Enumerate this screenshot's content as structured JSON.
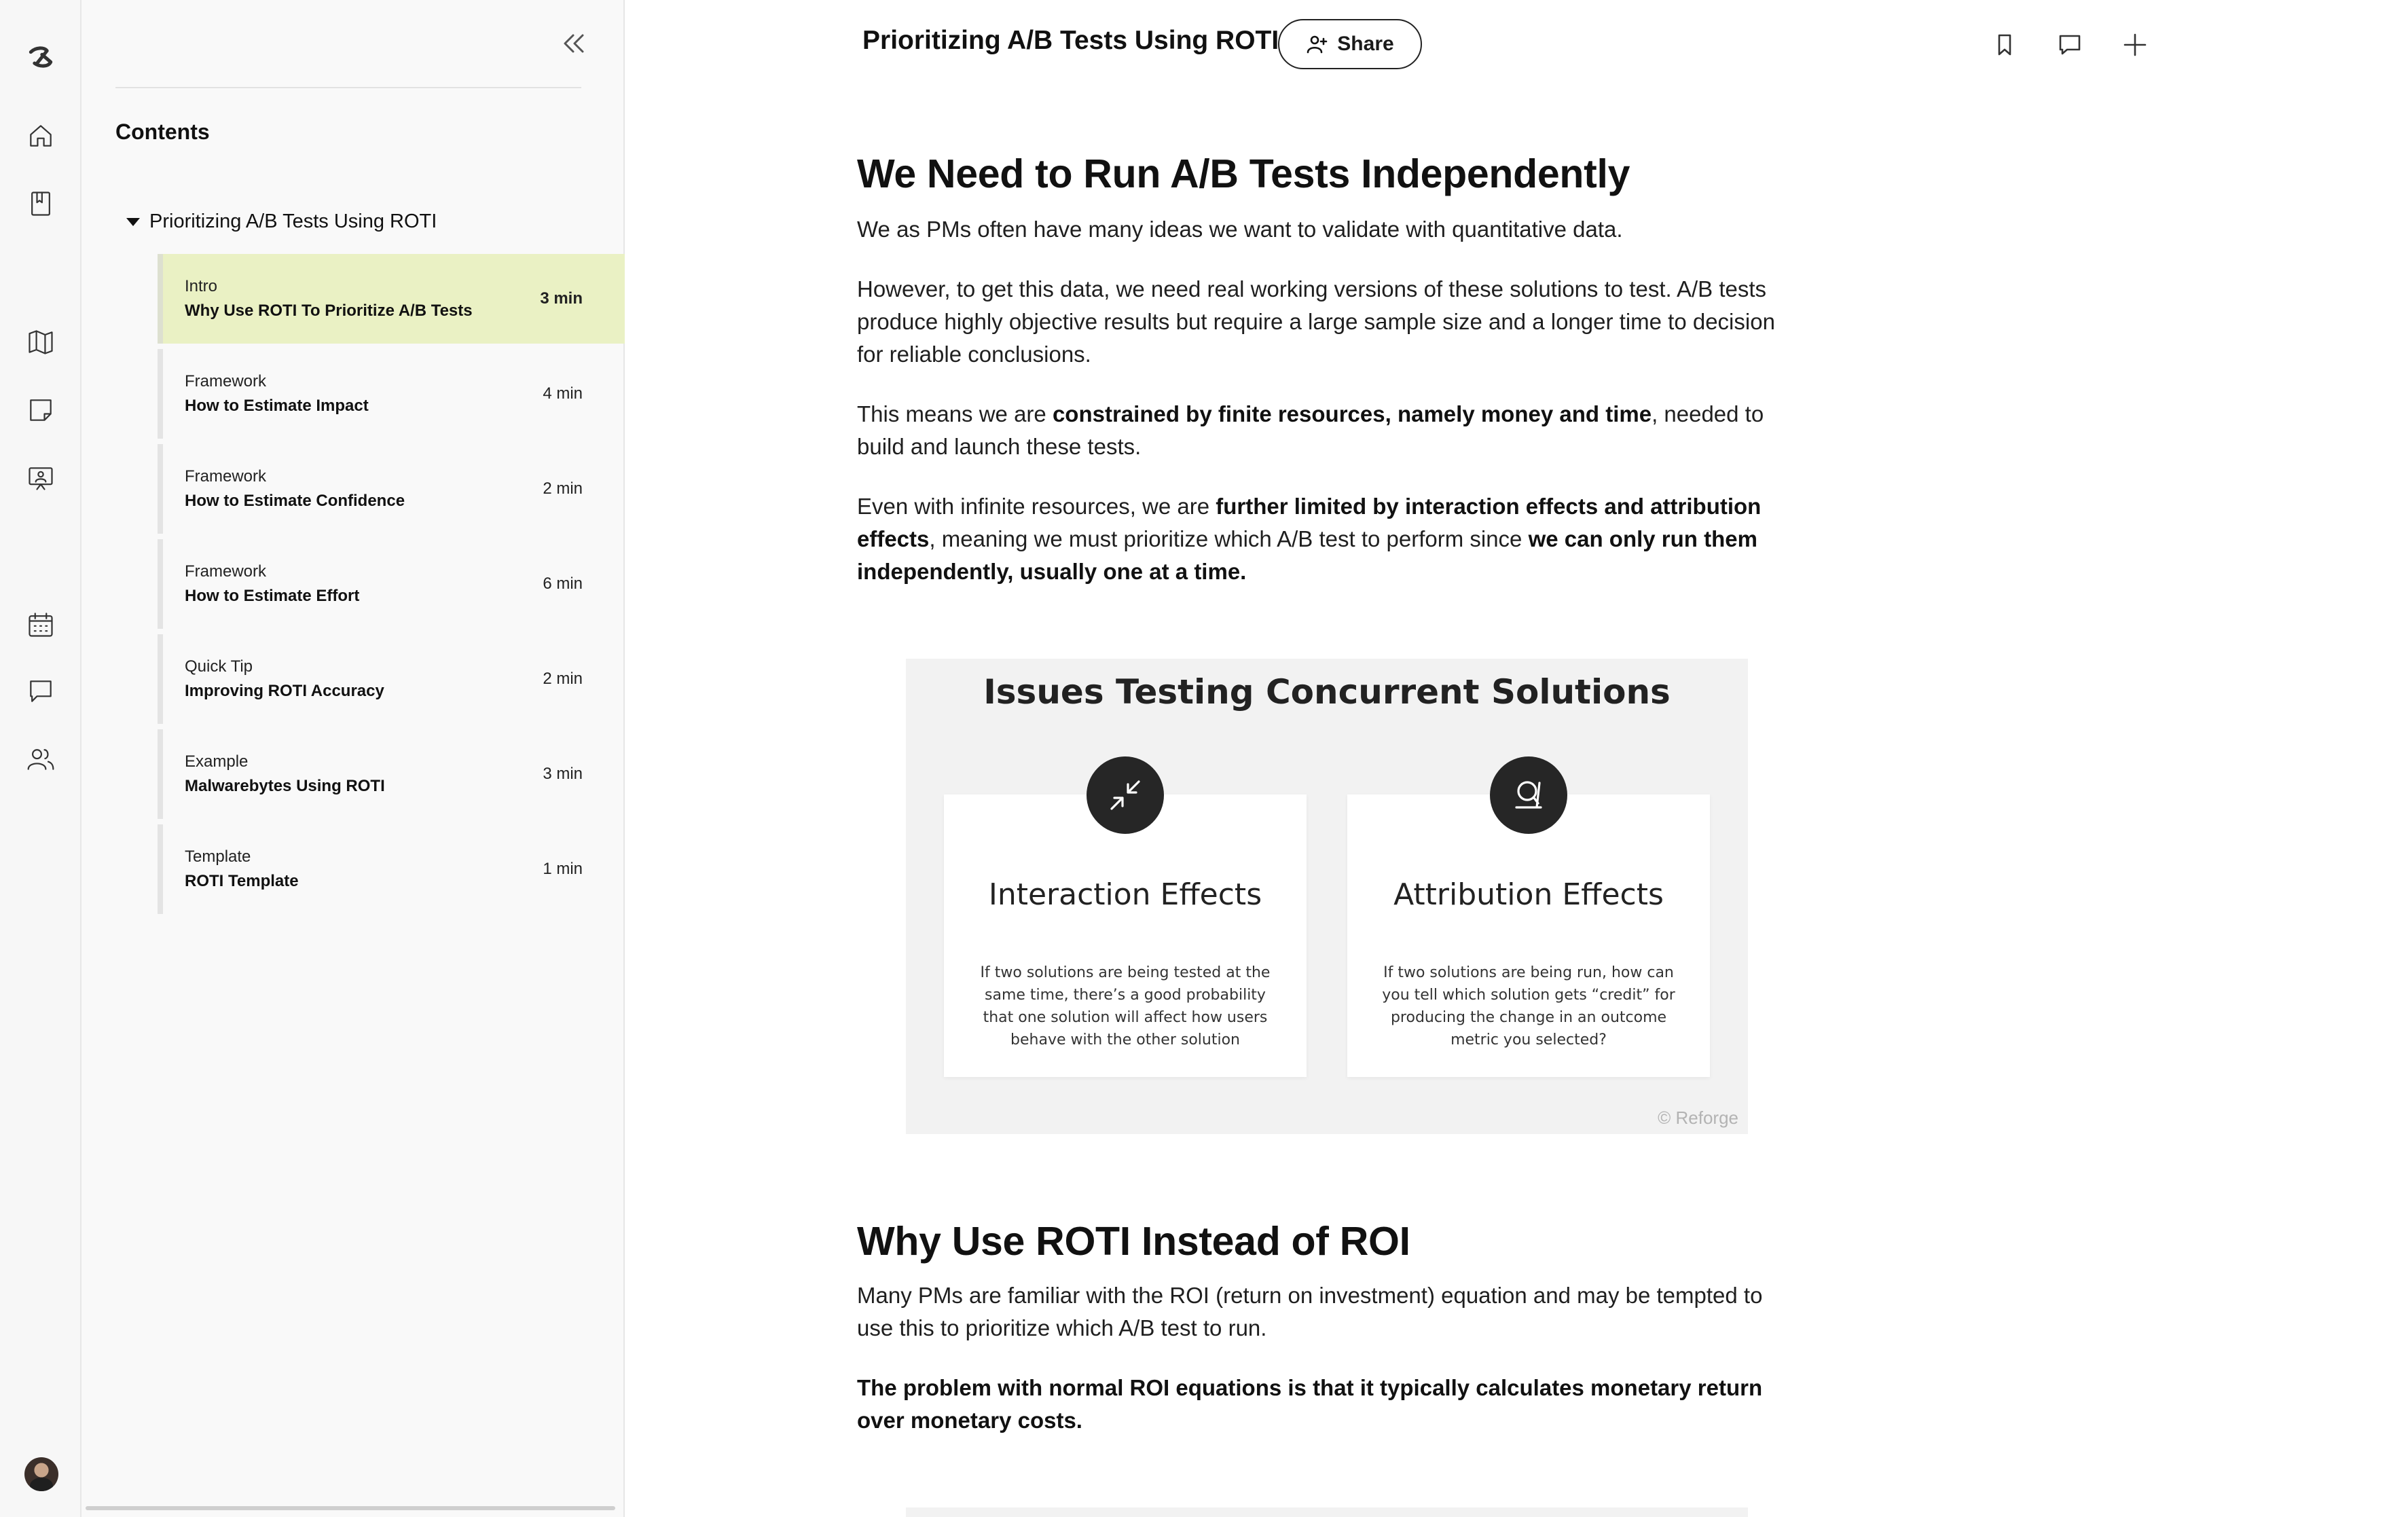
{
  "rail": {
    "items": [
      "logo-icon",
      "home-icon",
      "bookmark-book-icon",
      "map-icon",
      "note-icon",
      "presentation-icon",
      "calendar-icon",
      "chat-icon",
      "people-icon",
      "avatar"
    ]
  },
  "sidebar": {
    "contents_title": "Contents",
    "section_title": "Prioritizing A/B Tests Using ROTI",
    "items": [
      {
        "type": "Intro",
        "title": "Why Use ROTI To Prioritize A/B Tests",
        "time": "3 min",
        "active": true
      },
      {
        "type": "Framework",
        "title": "How to Estimate Impact",
        "time": "4 min",
        "active": false
      },
      {
        "type": "Framework",
        "title": "How to Estimate Confidence",
        "time": "2 min",
        "active": false
      },
      {
        "type": "Framework",
        "title": "How to Estimate Effort",
        "time": "6 min",
        "active": false
      },
      {
        "type": "Quick Tip",
        "title": "Improving ROTI Accuracy",
        "time": "2 min",
        "active": false
      },
      {
        "type": "Example",
        "title": "Malwarebytes Using ROTI",
        "time": "3 min",
        "active": false
      },
      {
        "type": "Template",
        "title": "ROTI Template",
        "time": "1 min",
        "active": false
      }
    ]
  },
  "header": {
    "title": "Prioritizing A/B Tests Using ROTI",
    "share_label": "Share"
  },
  "article": {
    "h1_a": "We Need to Run A/B Tests Independently",
    "p1": "We as PMs often have many ideas we want to validate with quantitative data.",
    "p2": "However, to get this data, we need real working versions of these solutions to test. A/B tests produce highly objective results but require a large sample size and a longer time to decision for reliable conclusions.",
    "p3_a": "This means we are ",
    "p3_b": "constrained by finite resources, namely money and time",
    "p3_c": ", needed to build and launch these tests.",
    "p4_a": "Even with infinite resources, we are ",
    "p4_b": "further limited by interaction effects and attribution effects",
    "p4_c": ", meaning we must prioritize which A/B test to perform since ",
    "p4_d": "we can only run them independently, usually one at a time.",
    "figure": {
      "title": "Issues Testing Concurrent Solutions",
      "cards": [
        {
          "title": "Interaction Effects",
          "body": "If two solutions are being tested at the same time, there’s a good probability that one solution will affect how users behave with the other solution"
        },
        {
          "title": "Attribution Effects",
          "body": "If two solutions are being run, how can you tell which solution gets “credit” for producing the change in an outcome metric you selected?"
        }
      ],
      "watermark": "© Reforge"
    },
    "h1_b": "Why Use ROTI Instead of ROI",
    "p5": "Many PMs are familiar with the ROI (return on investment) equation and may be tempted to use this to prioritize which A/B test to run.",
    "p6": "The problem with normal ROI equations is that it typically calculates monetary return over monetary costs."
  }
}
